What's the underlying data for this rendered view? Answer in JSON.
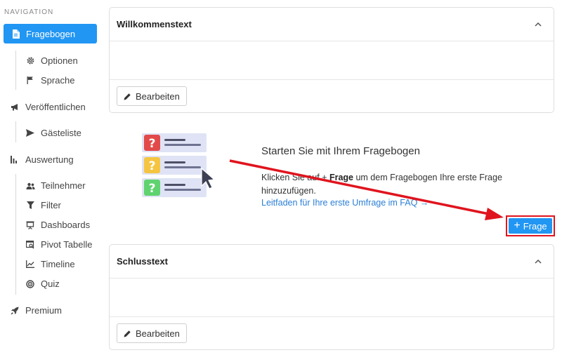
{
  "nav": {
    "title": "NAVIGATION",
    "fragebogen": "Fragebogen",
    "optionen": "Optionen",
    "sprache": "Sprache",
    "veroeffentlichen": "Veröffentlichen",
    "gaesteliste": "Gästeliste",
    "auswertung": "Auswertung",
    "teilnehmer": "Teilnehmer",
    "filter": "Filter",
    "dashboards": "Dashboards",
    "pivot": "Pivot Tabelle",
    "timeline": "Timeline",
    "quiz": "Quiz",
    "premium": "Premium"
  },
  "welcome_card": {
    "title": "Willkommenstext",
    "edit_label": "Bearbeiten"
  },
  "end_card": {
    "title": "Schlusstext",
    "edit_label": "Bearbeiten"
  },
  "empty_state": {
    "title": "Starten Sie mit Ihrem Fragebogen",
    "text_prefix": "Klicken Sie auf + ",
    "text_bold": "Frage",
    "text_suffix": " um dem Fragebogen Ihre erste Frage hinzuzufügen.",
    "link": "Leitfaden für Ihre erste Umfrage im FAQ →"
  },
  "add_question_button": {
    "plus": "+",
    "label": "Frage"
  },
  "colors": {
    "accent": "#2196F3",
    "highlight": "#e0141e"
  }
}
